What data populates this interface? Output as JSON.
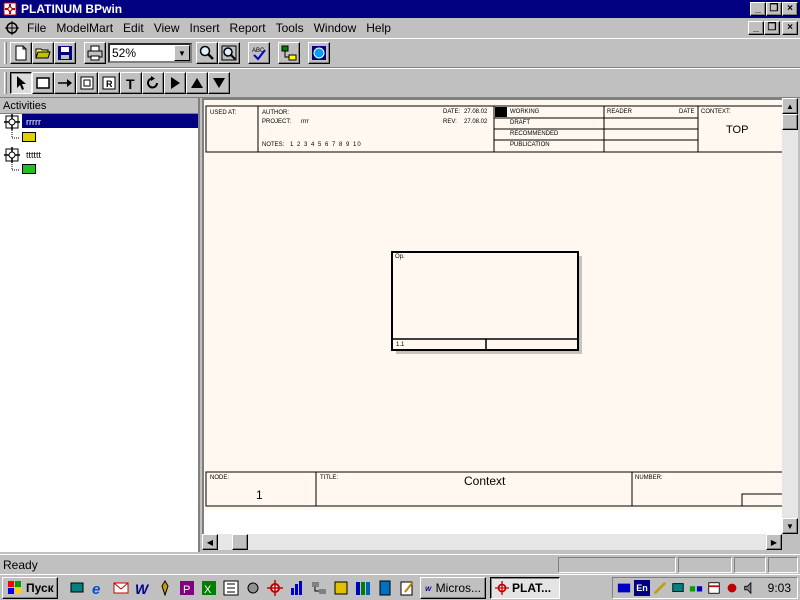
{
  "app": {
    "title": "PLATINUM BPwin"
  },
  "window_buttons": {
    "minimize": "_",
    "restore": "❐",
    "close": "×"
  },
  "menu": [
    "File",
    "ModelMart",
    "Edit",
    "View",
    "Insert",
    "Report",
    "Tools",
    "Window",
    "Help"
  ],
  "toolbar": {
    "zoom": "52%"
  },
  "left_panel": {
    "header": "Activities",
    "items": [
      {
        "label": "rrrrr"
      },
      {
        "label": "tttttt"
      }
    ]
  },
  "diagram": {
    "header": {
      "used_at": "USED AT:",
      "author_label": "AUTHOR:",
      "project_label": "PROJECT:",
      "project_value": "rrrr",
      "date_label": "DATE:",
      "date_value": "27.08.02",
      "rev_label": "REV:",
      "rev_value": "27.08.02",
      "notes_label": "NOTES:",
      "notes_value": "1 2 3 4 5 6 7 8 9 10",
      "status": [
        "WORKING",
        "DRAFT",
        "RECOMMENDED",
        "PUBLICATION"
      ],
      "reader_label": "READER",
      "reader_date_label": "DATE",
      "context_label": "CONTEXT:",
      "context_value": "TOP"
    },
    "activity": {
      "name": "Op.",
      "number": "1.1"
    },
    "footer": {
      "node_label": "NODE:",
      "node_value": "1",
      "title_label": "TITLE:",
      "title_value": "Context",
      "number_label": "NUMBER:"
    }
  },
  "status_bar": {
    "text": "Ready"
  },
  "taskbar": {
    "start": "Пуск",
    "tasks": [
      {
        "label": "Micros..."
      },
      {
        "label": "PLAT..."
      }
    ],
    "tray_lang": "En",
    "clock": "9:03"
  },
  "colors": {
    "title_bar": "#000080",
    "sheet": "#fff8f0",
    "selection": "#000080"
  }
}
